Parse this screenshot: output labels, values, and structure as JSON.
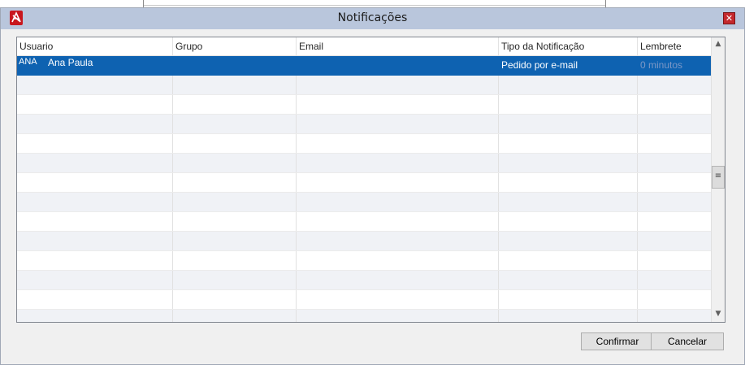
{
  "window": {
    "title": "Notificações",
    "close_glyph": "✕",
    "app_icon": "app-logo-icon"
  },
  "grid": {
    "columns": [
      "Usuario",
      "Grupo",
      "Email",
      "Tipo da Notificação",
      "Lembrete"
    ],
    "rows": [
      {
        "usuario_code": "ANA",
        "usuario_name": "Ana Paula",
        "grupo": "",
        "email": "",
        "tipo": "Pedido por e-mail",
        "lembrete": "0 minutos",
        "selected": true
      }
    ],
    "empty_row_count": 13
  },
  "scrollbar": {
    "up_glyph": "▲",
    "down_glyph": "▼",
    "thumb_glyph": "≡"
  },
  "buttons": {
    "confirm": "Confirmar",
    "cancel": "Cancelar"
  },
  "colors": {
    "selection": "#0e62b1",
    "titlebar": "#b9c6dc",
    "alt_row": "#f0f2f6"
  }
}
